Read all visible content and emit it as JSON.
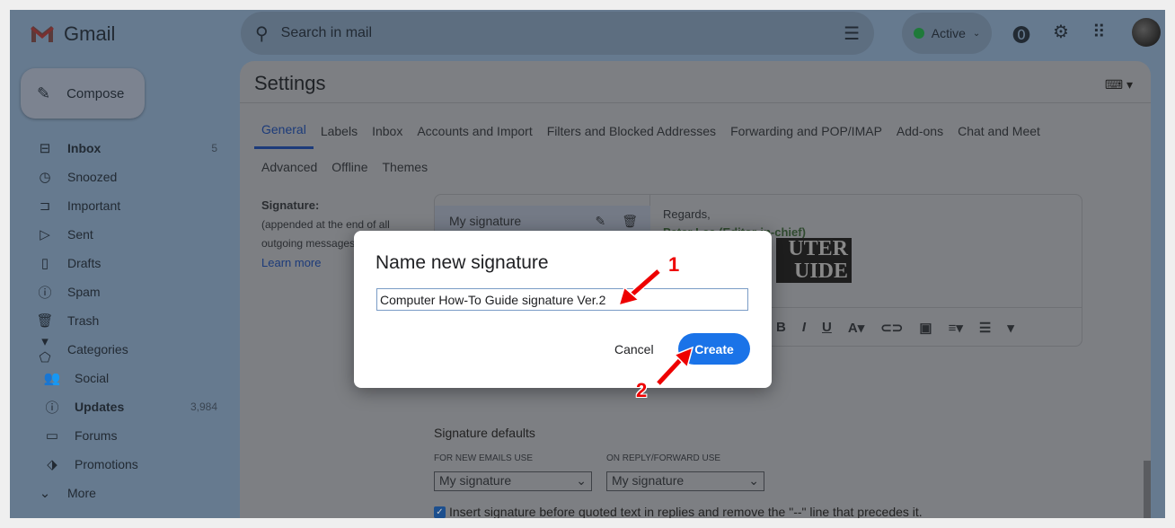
{
  "header": {
    "app_name": "Gmail",
    "search_placeholder": "Search in mail",
    "status": "Active",
    "status_color": "#1e8e3e"
  },
  "compose_label": "Compose",
  "sidebar": {
    "items": [
      {
        "label": "Inbox",
        "icon": "inbox-icon",
        "glyph": "⊟",
        "count": "5",
        "bold": true
      },
      {
        "label": "Snoozed",
        "icon": "clock-icon",
        "glyph": "◷"
      },
      {
        "label": "Important",
        "icon": "important-icon",
        "glyph": "⊐"
      },
      {
        "label": "Sent",
        "icon": "send-icon",
        "glyph": "▷"
      },
      {
        "label": "Drafts",
        "icon": "draft-icon",
        "glyph": "▯"
      },
      {
        "label": "Spam",
        "icon": "spam-icon",
        "glyph": "ⓘ"
      },
      {
        "label": "Trash",
        "icon": "trash-icon",
        "glyph": "🗑"
      },
      {
        "label": "Categories",
        "icon": "label-icon",
        "glyph": "▾ ⬠"
      },
      {
        "label": "Social",
        "icon": "people-icon",
        "glyph": "👥",
        "sub": true
      },
      {
        "label": "Updates",
        "icon": "info-icon",
        "glyph": "ⓘ",
        "count": "3,984",
        "bold": true,
        "sub": true
      },
      {
        "label": "Forums",
        "icon": "forum-icon",
        "glyph": "▭",
        "sub": true
      },
      {
        "label": "Promotions",
        "icon": "tag-icon",
        "glyph": "⬗",
        "sub": true
      },
      {
        "label": "More",
        "icon": "chevron-down-icon",
        "glyph": "⌄"
      }
    ]
  },
  "settings": {
    "title": "Settings",
    "tabs": [
      "General",
      "Labels",
      "Inbox",
      "Accounts and Import",
      "Filters and Blocked Addresses",
      "Forwarding and POP/IMAP",
      "Add-ons",
      "Chat and Meet",
      "Advanced",
      "Offline",
      "Themes"
    ],
    "signature": {
      "label": "Signature:",
      "desc": "(appended at the end of all outgoing messages)",
      "learn_more": "Learn more",
      "items": [
        "My signature"
      ],
      "editor_line1": "Regards,",
      "editor_line2": "Peter Lee (Editor-in-chief)",
      "logo_text": "COMPUTER HOW-TO GUIDE"
    },
    "defaults": {
      "title": "Signature defaults",
      "new_label": "FOR NEW EMAILS USE",
      "new_value": "My signature",
      "reply_label": "ON REPLY/FORWARD USE",
      "reply_value": "My signature",
      "checkbox_label": "Insert signature before quoted text in replies and remove the \"--\" line that precedes it.",
      "checked": true
    }
  },
  "dialog": {
    "title": "Name new signature",
    "input_value": "Computer How-To Guide signature Ver.2",
    "cancel": "Cancel",
    "create": "Create",
    "create_color": "#1a73e8"
  },
  "annotations": {
    "step1": "1",
    "step2": "2"
  }
}
